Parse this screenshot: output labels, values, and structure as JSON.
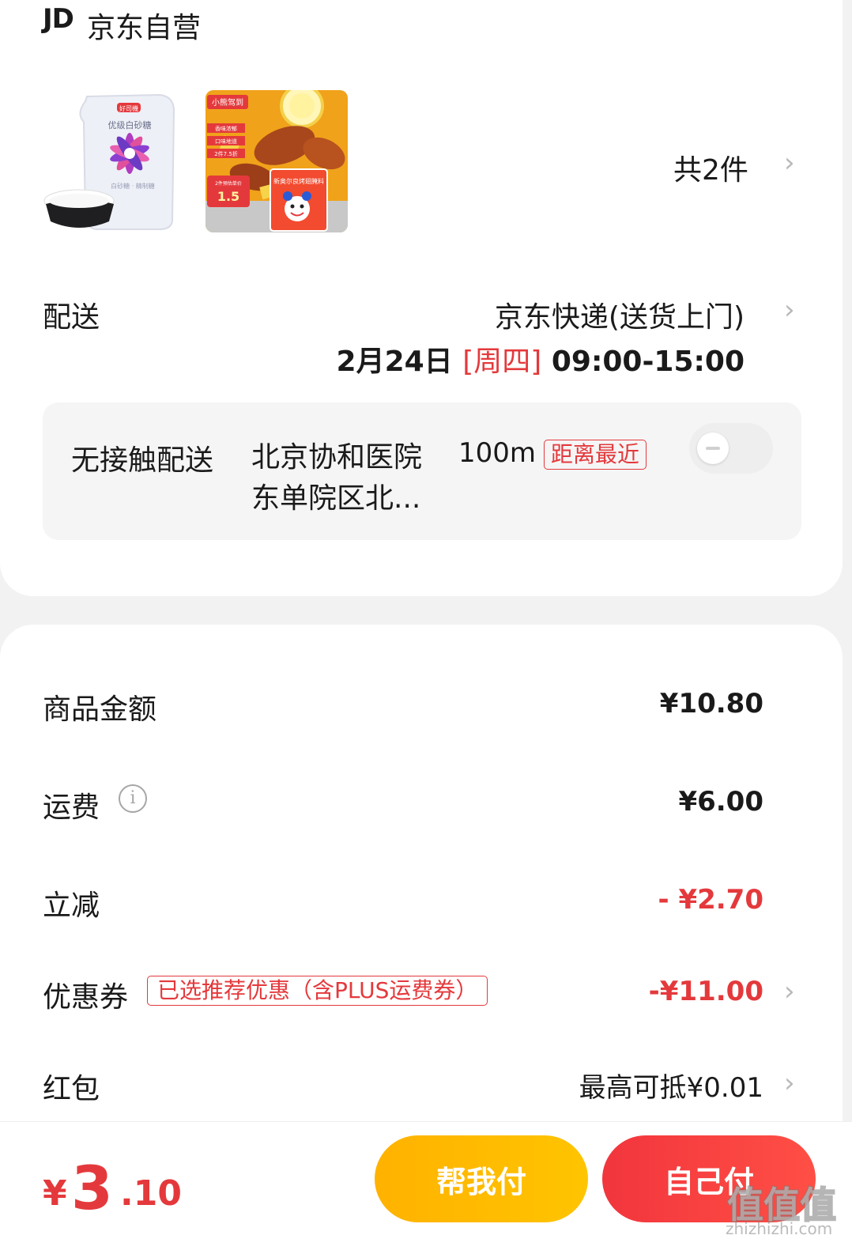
{
  "shop": {
    "logo": "JD",
    "name": "京东自营"
  },
  "products": {
    "count_label": "共2件",
    "items": [
      {
        "name_icon": "sugar-pouch-image",
        "brand": "好司機",
        "label": "优级白砂糖",
        "sub": "白砂糖 · 精制糖"
      },
      {
        "name_icon": "chicken-wing-seasoning-image",
        "brand": "小熊驾到",
        "badge": "2件预估单价",
        "price": "1.5",
        "lines": [
          "香味浓郁",
          "口味地道",
          "2件7.5折"
        ],
        "pack": "新奥尔良烤翅腌料"
      }
    ]
  },
  "delivery": {
    "label": "配送",
    "method": "京东快递(送货上门)",
    "date": "2月24日",
    "weekday": "[周四]",
    "time": "09:00-15:00"
  },
  "contactless": {
    "title": "无接触配送",
    "place": "北京协和医院东单院区北...",
    "distance": "100m",
    "badge": "距离最近"
  },
  "summary": {
    "goods_label": "商品金额",
    "goods_value": "¥10.80",
    "shipping_label": "运费",
    "shipping_value": "¥6.00",
    "discount_label": "立减",
    "discount_value": "- ¥2.70",
    "coupon_label": "优惠券",
    "coupon_badge": "已选推荐优惠（含PLUS运费券）",
    "coupon_value": "-¥11.00",
    "redpacket_label": "红包",
    "redpacket_value": "最高可抵¥0.01"
  },
  "footer": {
    "currency": "¥",
    "total_int": "3",
    "total_dec": ".10",
    "help_pay": "帮我付",
    "self_pay": "自己付",
    "watermark": "值值值",
    "watermark_sub": "zhizhizhi.com"
  },
  "colors": {
    "accent_red": "#e4393c",
    "help_yellow": "#ffb200",
    "self_red": "#f2353d"
  }
}
